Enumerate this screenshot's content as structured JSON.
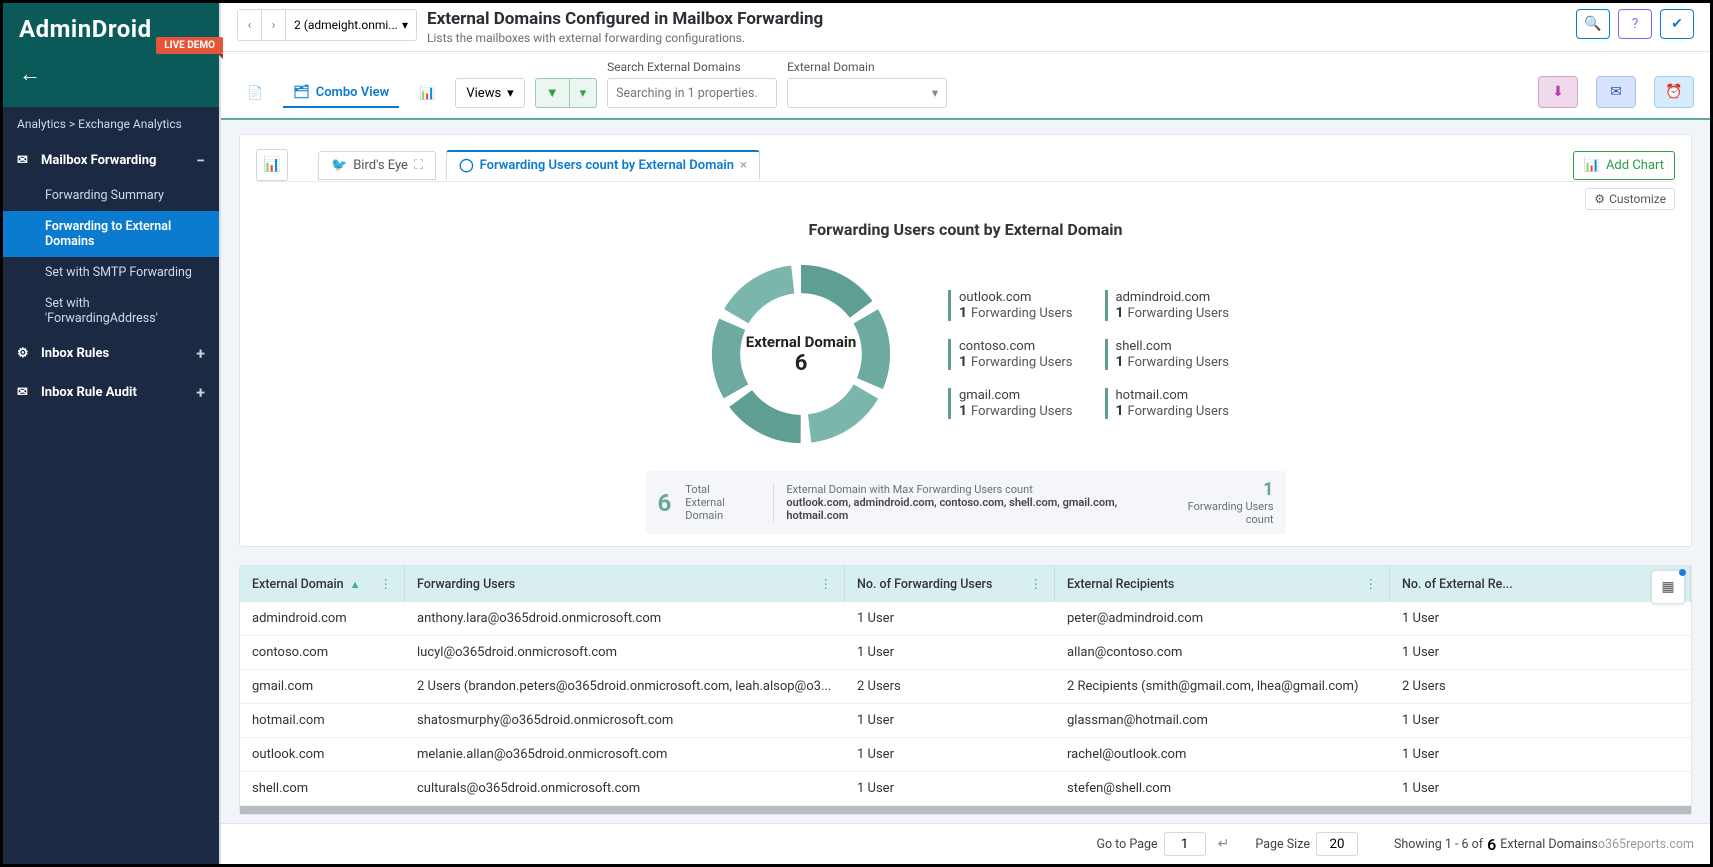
{
  "brand": {
    "name": "AdminDroid",
    "live_demo": "LIVE DEMO"
  },
  "breadcrumb": "Analytics > Exchange Analytics",
  "sidebar": {
    "section1": {
      "label": "Mailbox Forwarding",
      "items": [
        {
          "label": "Forwarding Summary"
        },
        {
          "label": "Forwarding to External Domains"
        },
        {
          "label": "Set with SMTP Forwarding"
        },
        {
          "label": "Set with 'ForwardingAddress'"
        }
      ]
    },
    "section2": {
      "label": "Inbox Rules"
    },
    "section3": {
      "label": "Inbox Rule Audit"
    }
  },
  "header": {
    "selector": "2 (admeight.onmi...",
    "title": "External Domains Configured in Mailbox Forwarding",
    "subtitle": "Lists the mailboxes with external forwarding configurations."
  },
  "toolbar": {
    "combo": "Combo View",
    "views": "Views",
    "search_label": "Search External Domains",
    "search_placeholder": "Searching in 1 properties.",
    "ext_label": "External Domain"
  },
  "tabs": {
    "birds_eye": "Bird's Eye",
    "active": "Forwarding Users count by External Domain",
    "add": "Add Chart",
    "customize": "Customize"
  },
  "chart_data": {
    "type": "pie",
    "title": "Forwarding Users count by External Domain",
    "center_label": "External Domain",
    "center_value": "6",
    "series": [
      {
        "label": "outlook.com",
        "value": 1,
        "unit": "Forwarding Users"
      },
      {
        "label": "admindroid.com",
        "value": 1,
        "unit": "Forwarding Users"
      },
      {
        "label": "contoso.com",
        "value": 1,
        "unit": "Forwarding Users"
      },
      {
        "label": "shell.com",
        "value": 1,
        "unit": "Forwarding Users"
      },
      {
        "label": "gmail.com",
        "value": 1,
        "unit": "Forwarding Users"
      },
      {
        "label": "hotmail.com",
        "value": 1,
        "unit": "Forwarding Users"
      }
    ],
    "summary": {
      "total": "6",
      "total_label": "Total",
      "total_sub": "External Domain",
      "max_label": "External Domain with Max Forwarding Users count",
      "max_domains": "outlook.com, admindroid.com, contoso.com, shell.com, gmail.com, hotmail.com",
      "right_num": "1",
      "right_label": "Forwarding Users count"
    }
  },
  "table": {
    "columns": [
      "External Domain",
      "Forwarding Users",
      "No. of Forwarding Users",
      "External Recipients",
      "No. of External Re..."
    ],
    "rows": [
      {
        "domain": "admindroid.com",
        "fu": "anthony.lara@o365droid.onmicrosoft.com",
        "nfu": "1 User",
        "er": "peter@admindroid.com",
        "ner": "1 User"
      },
      {
        "domain": "contoso.com",
        "fu": "lucyl@o365droid.onmicrosoft.com",
        "nfu": "1 User",
        "er": "allan@contoso.com",
        "ner": "1 User"
      },
      {
        "domain": "gmail.com",
        "fu": "2 Users (brandon.peters@o365droid.onmicrosoft.com, leah.alsop@o3...",
        "nfu": "2 Users",
        "er": "2 Recipients (smith@gmail.com, lhea@gmail.com)",
        "ner": "2 Users"
      },
      {
        "domain": "hotmail.com",
        "fu": "shatosmurphy@o365droid.onmicrosoft.com",
        "nfu": "1 User",
        "er": "glassman@hotmail.com",
        "ner": "1 User"
      },
      {
        "domain": "outlook.com",
        "fu": "melanie.allan@o365droid.onmicrosoft.com",
        "nfu": "1 User",
        "er": "rachel@outlook.com",
        "ner": "1 User"
      },
      {
        "domain": "shell.com",
        "fu": "culturals@o365droid.onmicrosoft.com",
        "nfu": "1 User",
        "er": "stefen@shell.com",
        "ner": "1 User"
      }
    ]
  },
  "footer": {
    "goto": "Go to Page",
    "page": "1",
    "page_size_label": "Page Size",
    "page_size": "20",
    "showing_pre": "Showing 1 - 6 of",
    "showing_total": "6",
    "showing_post": "External Domains",
    "watermark": "o365reports.com"
  }
}
